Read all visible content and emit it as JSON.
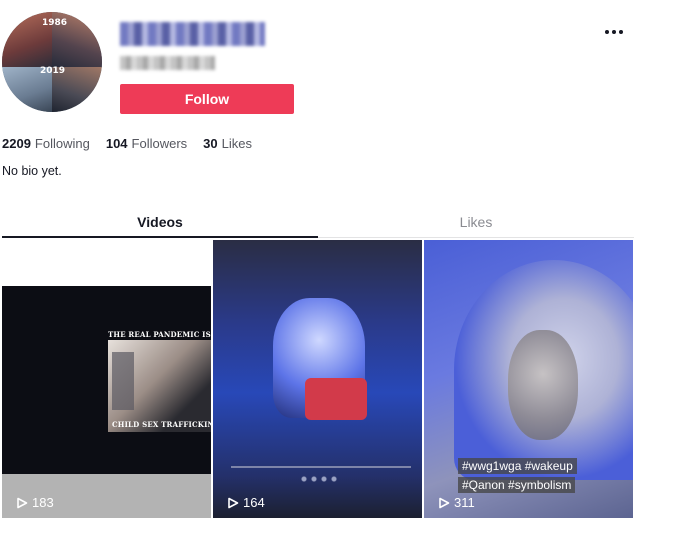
{
  "profile": {
    "avatar_labels": [
      "1986",
      "2019"
    ],
    "follow_label": "Follow",
    "stats": [
      {
        "value": "2209",
        "label": "Following"
      },
      {
        "value": "104",
        "label": "Followers"
      },
      {
        "value": "30",
        "label": "Likes"
      }
    ],
    "bio": "No bio yet."
  },
  "tabs": [
    {
      "label": "Videos",
      "active": true
    },
    {
      "label": "Likes",
      "active": false
    }
  ],
  "videos": [
    {
      "views": "183",
      "overlay_top": "THE REAL PANDEMIC IS",
      "overlay_bottom": "CHILD SEX TRAFFICKING"
    },
    {
      "views": "164"
    },
    {
      "views": "311",
      "caption_lines": [
        "#wwg1wga #wakeup",
        "#Qanon #symbolism"
      ]
    }
  ],
  "colors": {
    "accent": "#ee3b57",
    "text": "#161823",
    "muted": "#8a8b91"
  },
  "icons": [
    "more-icon",
    "play-icon"
  ]
}
